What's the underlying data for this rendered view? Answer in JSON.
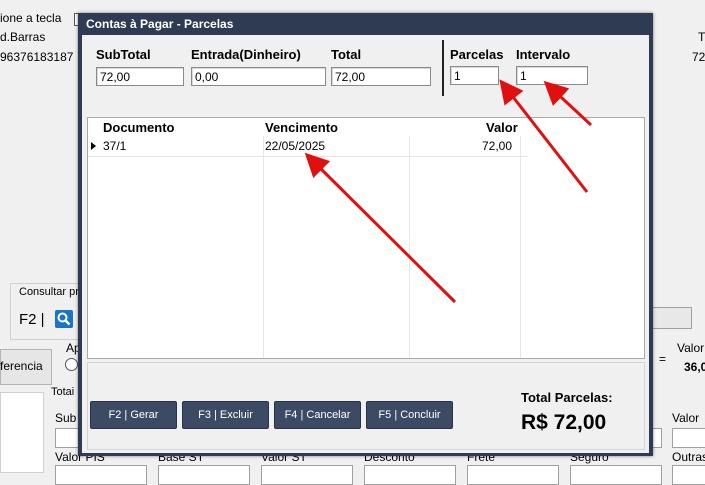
{
  "background": {
    "top_label": "ione a tecla",
    "col_barras": "d.Barras",
    "barcode_value": "96376183187",
    "right_top_t": "T",
    "right_top_72": "72",
    "consultar": "Consultar pr",
    "f2": "F2 |",
    "ferencia": "ferencia",
    "ap": "Ap",
    "totais": "Totai",
    "sub": "Sub",
    "valor_top_right": "Valor",
    "valor_top_right_value": "36,0",
    "equals": "=",
    "valor_right": "Valor",
    "valor_pis": "Valor PIS",
    "base_st": "Base ST",
    "valor_st": "Valor ST",
    "desconto": "Desconto",
    "frete": "Frete",
    "seguro": "Seguro",
    "outras": "Outras"
  },
  "dialog": {
    "title": "Contas à Pagar - Parcelas",
    "subtotal_label": "SubTotal",
    "subtotal_value": "72,00",
    "entrada_label": "Entrada(Dinheiro)",
    "entrada_value": "0,00",
    "total_label": "Total",
    "total_value": "72,00",
    "parcelas_label": "Parcelas",
    "parcelas_value": "1",
    "intervalo_label": "Intervalo",
    "intervalo_value": "1",
    "grid": {
      "headers": [
        "Documento",
        "Vencimento",
        "Valor"
      ],
      "rows": [
        {
          "documento": "37/1",
          "vencimento": "22/05/2025",
          "valor": "72,00"
        }
      ]
    },
    "buttons": {
      "gerar": "F2 | Gerar",
      "excluir": "F3 | Excluir",
      "cancelar": "F4 | Cancelar",
      "concluir": "F5 | Concluir"
    },
    "total_parcelas_label": "Total Parcelas:",
    "total_parcelas_value": "R$ 72,00"
  },
  "colors": {
    "dialog_frame": "#2f3b52",
    "button_bg": "#3c4a64",
    "arrow": "#e01010",
    "search_icon": "#1a73c9"
  },
  "icons": [
    "search-icon",
    "row-indicator-icon",
    "annotation-arrow"
  ]
}
